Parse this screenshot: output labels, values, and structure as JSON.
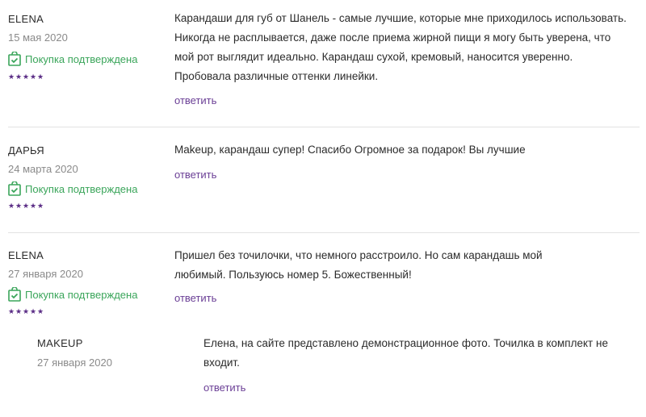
{
  "reviews": [
    {
      "author": "ELENA",
      "date": "15 мая 2020",
      "verified": "Покупка подтверждена",
      "rating": 5,
      "text": "Карандаши для губ от Шанель - самые лучшие, которые мне приходилось использовать. Никогда не расплывается, даже после приема жирной пищи я могу быть уверена, что мой рот выглядит идеально. Карандаш сухой, кремовый, наносится уверенно. Пробовала различные оттенки линейки.",
      "reply_label": "ответить"
    },
    {
      "author": "ДАРЬЯ",
      "date": "24 марта 2020",
      "verified": "Покупка подтверждена",
      "rating": 5,
      "text": "Makeup, карандаш супер! Спасибо Огромное за подарок! Вы лучшие",
      "reply_label": "ответить"
    },
    {
      "author": "ELENA",
      "date": "27 января 2020",
      "verified": "Покупка подтверждена",
      "rating": 5,
      "text": "Пришел без точилочки, что немного расстроило. Но сам карандашь мой любимый. Пользуюсь номер 5. Божественный!",
      "reply_label": "ответить"
    }
  ],
  "answer": {
    "author": "MAKEUP",
    "date": "27 января 2020",
    "text": "Елена, на сайте представлено демонстрационное фото. Точилка в комплект не входит.",
    "reply_label": "ответить"
  },
  "colors": {
    "accent": "#6a3e95",
    "verified": "#3aa55a",
    "star": "#5b2d86"
  },
  "icons": {
    "verified": "verified-bag-icon",
    "star": "star-icon"
  }
}
